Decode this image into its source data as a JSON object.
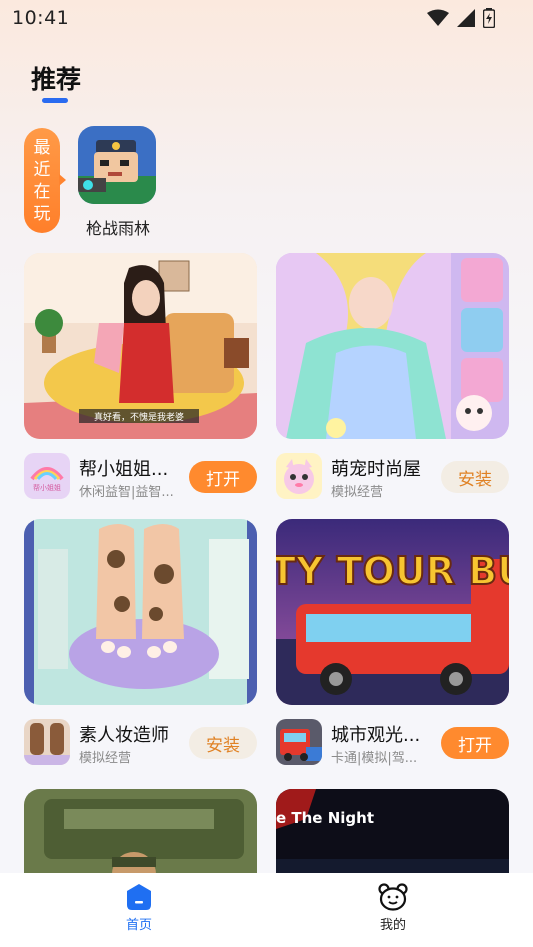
{
  "status": {
    "time": "10:41"
  },
  "header": {
    "title": "推荐"
  },
  "recent": {
    "tag": "最近在玩",
    "apps": [
      {
        "name": "枪战雨林"
      }
    ]
  },
  "cards": [
    {
      "name": "帮小姐姐...",
      "tags": "休闲益智|益智...",
      "button": "打开",
      "image_caption": "真好看，不愧是我老婆",
      "icon_text": "帮小姐姐"
    },
    {
      "name": "萌宠时尚屋",
      "tags": "模拟经营",
      "button": "安装"
    },
    {
      "name": "素人妆造师",
      "tags": "模拟经营",
      "button": "安装"
    },
    {
      "name": "城市观光...",
      "tags": "卡通|模拟|驾...",
      "button": "打开",
      "image_text": "TY TOUR BUS"
    },
    {
      "image_text": ""
    },
    {
      "image_text": "e The Night"
    }
  ],
  "tabbar": {
    "home": "首页",
    "mine": "我的"
  },
  "colors": {
    "accent": "#2a6bf0",
    "open_button": "#ff8a2e",
    "install_button_text": "#e08225"
  }
}
